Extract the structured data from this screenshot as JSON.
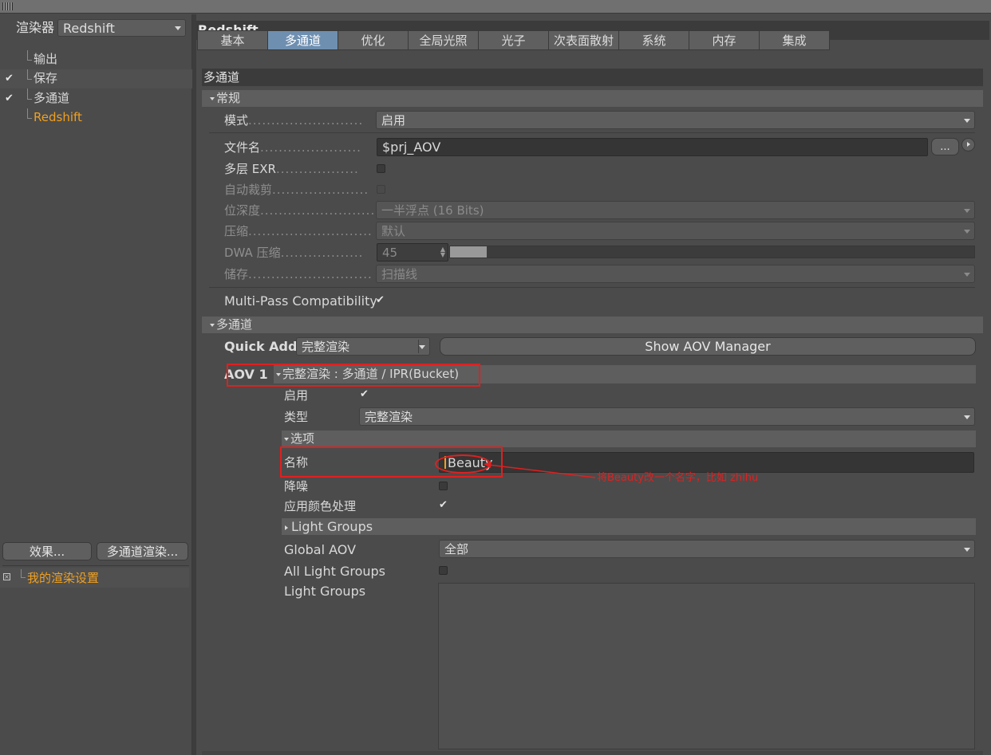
{
  "left": {
    "renderer_label": "渲染器",
    "renderer_value": "Redshift",
    "tree": [
      {
        "label": "输出",
        "checked": false
      },
      {
        "label": "保存",
        "checked": true
      },
      {
        "label": "多通道",
        "checked": true
      },
      {
        "label": "Redshift",
        "checked": false,
        "active": true
      }
    ],
    "effects_button": "效果...",
    "multipass_button": "多通道渲染...",
    "settings_item": "我的渲染设置"
  },
  "right": {
    "title": "Redshift",
    "tabs": [
      "基本",
      "多通道",
      "优化",
      "全局光照",
      "光子",
      "次表面散射",
      "系统",
      "内存",
      "集成"
    ],
    "active_tab": "多通道",
    "section_title": "多通道",
    "general": {
      "header": "常规",
      "mode_label": "模式",
      "mode_value": "启用",
      "filename_label": "文件名",
      "filename_value": "$prj_AOV",
      "browse_button": "...",
      "multilayer_exr_label": "多层 EXR",
      "autocrop_label": "自动裁剪",
      "bitdepth_label": "位深度",
      "bitdepth_value": "一半浮点 (16 Bits)",
      "compression_label": "压缩",
      "compression_value": "默认",
      "dwa_label": "DWA 压缩",
      "dwa_value": "45",
      "dwa_fraction": 0.07,
      "storage_label": "储存",
      "storage_value": "扫描线",
      "compat_label": "Multi-Pass Compatibility"
    },
    "multipass": {
      "header": "多通道",
      "quick_add_label": "Quick Add",
      "quick_add_value": "完整渲染",
      "show_manager_button": "Show AOV Manager",
      "aov_label": "AOV 1",
      "aov_title": "完整渲染 : 多通道 / IPR(Bucket)",
      "enable_label": "启用",
      "type_label": "类型",
      "type_value": "完整渲染",
      "options_header": "选项",
      "name_label": "名称",
      "name_value": "Beauty",
      "denoise_label": "降噪",
      "color_proc_label": "应用颜色处理",
      "light_groups_header": "Light Groups",
      "global_aov_label": "Global AOV",
      "global_aov_value": "全部",
      "all_light_groups_label": "All Light Groups",
      "light_groups_label": "Light Groups"
    },
    "annotation": "将Beauty改一个名字，比如 zhihu"
  },
  "colors": {
    "accent_orange": "#f0a020",
    "active_tab": "#6f8fb0",
    "annotation_red": "#e02020"
  }
}
